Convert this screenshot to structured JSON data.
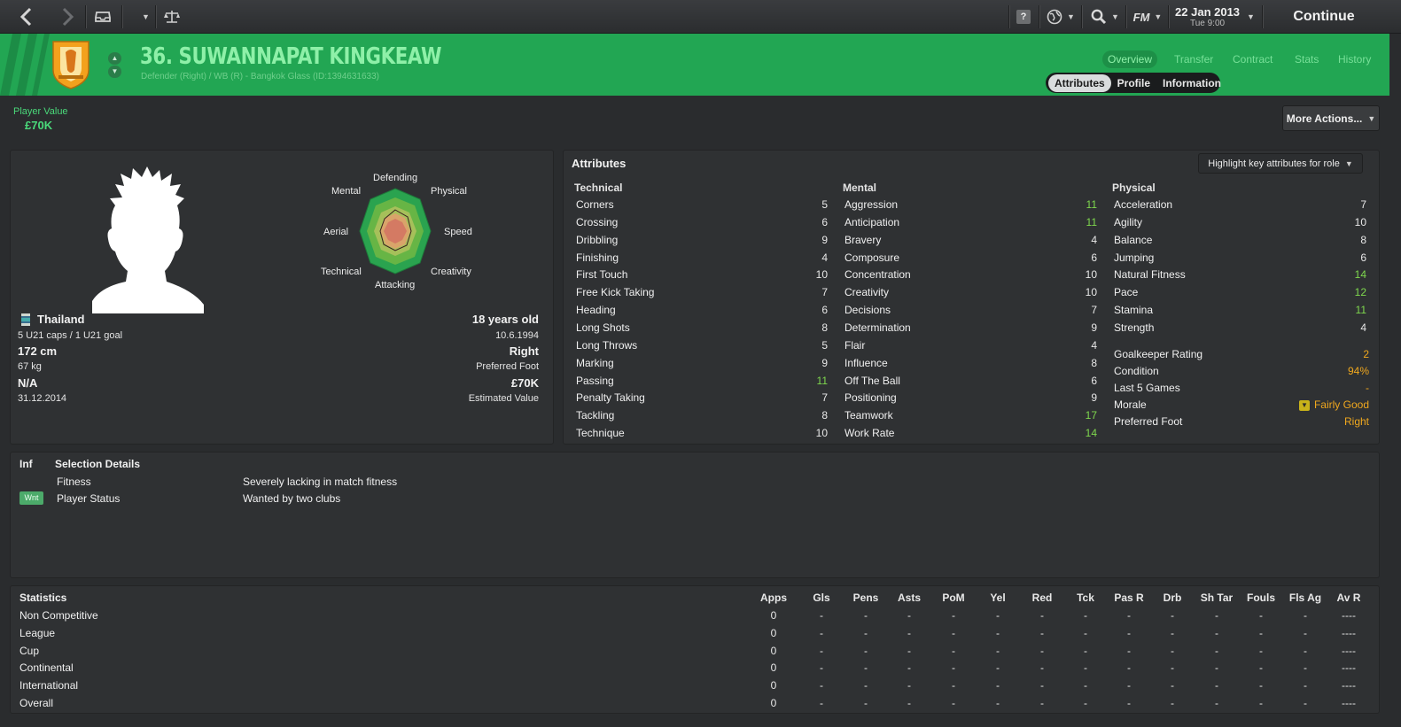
{
  "topbar": {
    "date": "22 Jan 2013",
    "time": "Tue 9:00",
    "continue_label": "Continue",
    "fm_label": "FM"
  },
  "header": {
    "player_name": "36. SUWANNAPAT KINGKEAW",
    "subtitle": "Defender (Right) / WB (R) - Bangkok Glass (ID:1394631633)",
    "nav": [
      "Overview",
      "Transfer",
      "Contract",
      "Stats",
      "History"
    ],
    "subtabs": [
      "Attributes",
      "Profile",
      "Information"
    ],
    "accent": "#22a653"
  },
  "value_bar": {
    "label": "Player Value",
    "value": "£70K",
    "more_actions": "More Actions..."
  },
  "profile": {
    "radar_labels": {
      "defending": "Defending",
      "physical": "Physical",
      "speed": "Speed",
      "creativity": "Creativity",
      "attacking": "Attacking",
      "technical": "Technical",
      "aerial": "Aerial",
      "mental": "Mental"
    },
    "nationality": "Thailand",
    "caps": "5 U21 caps / 1 U21 goal",
    "height": "172 cm",
    "weight": "67 kg",
    "contract_status": "N/A",
    "contract_expiry": "31.12.2014",
    "age": "18 years old",
    "dob": "10.6.1994",
    "foot": "Right",
    "foot_label": "Preferred Foot",
    "est_value": "£70K",
    "est_value_label": "Estimated Value"
  },
  "attributes": {
    "title": "Attributes",
    "highlight_button": "Highlight key attributes for role",
    "technical_title": "Technical",
    "mental_title": "Mental",
    "physical_title": "Physical",
    "technical": [
      {
        "name": "Corners",
        "value": "5",
        "cls": ""
      },
      {
        "name": "Crossing",
        "value": "6",
        "cls": ""
      },
      {
        "name": "Dribbling",
        "value": "9",
        "cls": ""
      },
      {
        "name": "Finishing",
        "value": "4",
        "cls": ""
      },
      {
        "name": "First Touch",
        "value": "10",
        "cls": ""
      },
      {
        "name": "Free Kick Taking",
        "value": "7",
        "cls": ""
      },
      {
        "name": "Heading",
        "value": "6",
        "cls": ""
      },
      {
        "name": "Long Shots",
        "value": "8",
        "cls": ""
      },
      {
        "name": "Long Throws",
        "value": "5",
        "cls": ""
      },
      {
        "name": "Marking",
        "value": "9",
        "cls": ""
      },
      {
        "name": "Passing",
        "value": "11",
        "cls": "g"
      },
      {
        "name": "Penalty Taking",
        "value": "7",
        "cls": ""
      },
      {
        "name": "Tackling",
        "value": "8",
        "cls": ""
      },
      {
        "name": "Technique",
        "value": "10",
        "cls": ""
      }
    ],
    "mental": [
      {
        "name": "Aggression",
        "value": "11",
        "cls": "g"
      },
      {
        "name": "Anticipation",
        "value": "11",
        "cls": "g"
      },
      {
        "name": "Bravery",
        "value": "4",
        "cls": ""
      },
      {
        "name": "Composure",
        "value": "6",
        "cls": ""
      },
      {
        "name": "Concentration",
        "value": "10",
        "cls": ""
      },
      {
        "name": "Creativity",
        "value": "10",
        "cls": ""
      },
      {
        "name": "Decisions",
        "value": "7",
        "cls": ""
      },
      {
        "name": "Determination",
        "value": "9",
        "cls": ""
      },
      {
        "name": "Flair",
        "value": "4",
        "cls": ""
      },
      {
        "name": "Influence",
        "value": "8",
        "cls": ""
      },
      {
        "name": "Off The Ball",
        "value": "6",
        "cls": ""
      },
      {
        "name": "Positioning",
        "value": "9",
        "cls": ""
      },
      {
        "name": "Teamwork",
        "value": "17",
        "cls": "g"
      },
      {
        "name": "Work Rate",
        "value": "14",
        "cls": "g"
      }
    ],
    "physical": [
      {
        "name": "Acceleration",
        "value": "7",
        "cls": ""
      },
      {
        "name": "Agility",
        "value": "10",
        "cls": ""
      },
      {
        "name": "Balance",
        "value": "8",
        "cls": ""
      },
      {
        "name": "Jumping",
        "value": "6",
        "cls": ""
      },
      {
        "name": "Natural Fitness",
        "value": "14",
        "cls": "g"
      },
      {
        "name": "Pace",
        "value": "12",
        "cls": "g"
      },
      {
        "name": "Stamina",
        "value": "11",
        "cls": "g"
      },
      {
        "name": "Strength",
        "value": "4",
        "cls": ""
      }
    ],
    "extra": [
      {
        "name": "Goalkeeper Rating",
        "value": "2",
        "cls": "o"
      },
      {
        "name": "Condition",
        "value": "94%",
        "cls": "o"
      },
      {
        "name": "Last 5 Games",
        "value": "-",
        "cls": "o"
      },
      {
        "name": "Morale",
        "value": "Fairly Good",
        "cls": "o"
      },
      {
        "name": "Preferred Foot",
        "value": "Right",
        "cls": "o"
      }
    ]
  },
  "selection": {
    "inf_label": "Inf",
    "title": "Selection Details",
    "rows": [
      {
        "label": "Fitness",
        "value": "Severely lacking in match fitness"
      },
      {
        "label": "Player Status",
        "value": "Wanted by two clubs",
        "badge": "Wnt"
      }
    ]
  },
  "statistics": {
    "title": "Statistics",
    "columns": [
      "Apps",
      "Gls",
      "Pens",
      "Asts",
      "PoM",
      "Yel",
      "Red",
      "Tck",
      "Pas R",
      "Drb",
      "Sh Tar",
      "Fouls",
      "Fls Ag",
      "Av R"
    ],
    "rows": [
      {
        "label": "Non Competitive",
        "cells": [
          "0",
          "-",
          "-",
          "-",
          "-",
          "-",
          "-",
          "-",
          "-",
          "-",
          "-",
          "-",
          "-",
          "----"
        ]
      },
      {
        "label": "League",
        "cells": [
          "0",
          "-",
          "-",
          "-",
          "-",
          "-",
          "-",
          "-",
          "-",
          "-",
          "-",
          "-",
          "-",
          "----"
        ]
      },
      {
        "label": "Cup",
        "cells": [
          "0",
          "-",
          "-",
          "-",
          "-",
          "-",
          "-",
          "-",
          "-",
          "-",
          "-",
          "-",
          "-",
          "----"
        ]
      },
      {
        "label": "Continental",
        "cells": [
          "0",
          "-",
          "-",
          "-",
          "-",
          "-",
          "-",
          "-",
          "-",
          "-",
          "-",
          "-",
          "-",
          "----"
        ]
      },
      {
        "label": "International",
        "cells": [
          "0",
          "-",
          "-",
          "-",
          "-",
          "-",
          "-",
          "-",
          "-",
          "-",
          "-",
          "-",
          "-",
          "----"
        ]
      },
      {
        "label": "Overall",
        "cells": [
          "0",
          "-",
          "-",
          "-",
          "-",
          "-",
          "-",
          "-",
          "-",
          "-",
          "-",
          "-",
          "-",
          "----"
        ]
      }
    ]
  }
}
